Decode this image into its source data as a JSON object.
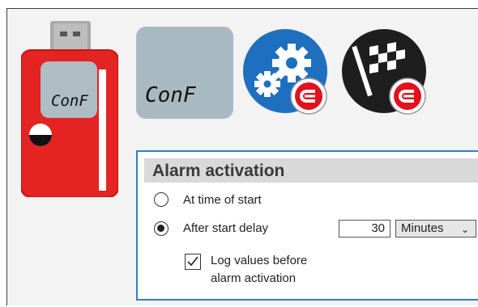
{
  "device": {
    "lcd_text": "ConF"
  },
  "toolbar": {
    "display_tile_text": "ConF",
    "configure_icon": "gears-icon",
    "start_icon": "checkered-flag-icon",
    "badge_icon": "e-logo-badge-icon"
  },
  "alarm_panel": {
    "title": "Alarm activation",
    "option_start": "At time of start",
    "option_delay": "After start delay",
    "selected_option": "delay",
    "delay_value": "30",
    "delay_unit": "Minutes",
    "log_values_checked": true,
    "log_values_label_line1": "Log values before",
    "log_values_label_line2": "alarm activation"
  },
  "colors": {
    "device_red": "#e42323",
    "accent_blue": "#1f6fc0",
    "panel_border": "#2f7fcf",
    "badge_red": "#e3101d"
  }
}
